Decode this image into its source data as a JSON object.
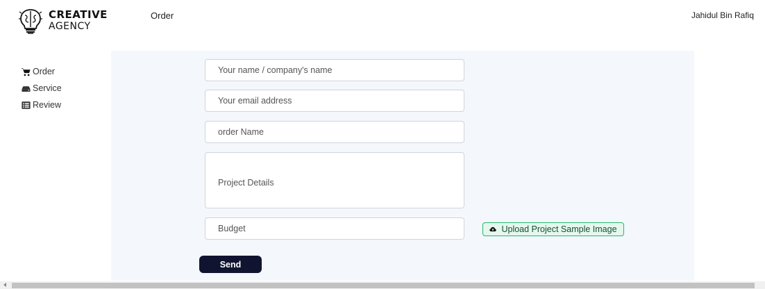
{
  "brand": {
    "line1": "CREATIVE",
    "line2": "AGENCY"
  },
  "header": {
    "page_title": "Order",
    "user_name": "Jahidul Bin Rafiq"
  },
  "sidebar": {
    "items": [
      {
        "label": "Order",
        "icon": "cart-icon"
      },
      {
        "label": "Service",
        "icon": "hdd-icon"
      },
      {
        "label": "Review",
        "icon": "list-icon"
      }
    ]
  },
  "form": {
    "name_placeholder": "Your name / company's name",
    "email_placeholder": "Your email address",
    "order_placeholder": "order Name",
    "details_placeholder": "Project Details",
    "budget_placeholder": "Budget",
    "upload_label": "Upload Project Sample Image",
    "send_label": "Send"
  },
  "colors": {
    "page_background": "#f4f7fc",
    "send_button": "#111430",
    "upload_border": "#27b56b",
    "upload_background": "#e4f8ee"
  }
}
